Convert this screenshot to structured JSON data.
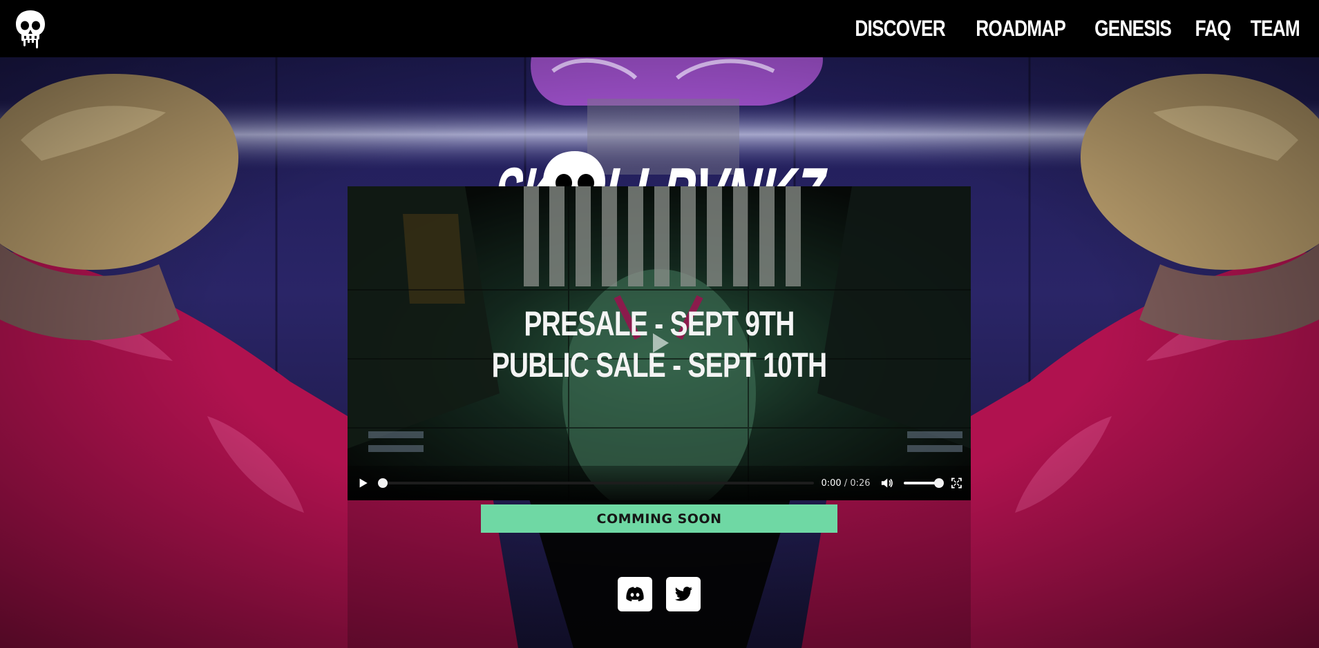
{
  "nav": {
    "logo_icon": "skull-icon",
    "links": [
      {
        "label": "DISCOVER"
      },
      {
        "label": "ROADMAP"
      },
      {
        "label": "GENESIS"
      },
      {
        "label": "FAQ"
      },
      {
        "label": "TEAM"
      }
    ]
  },
  "brand": {
    "text_before": "SK",
    "text_after": "LLPVNKZ",
    "skull_icon": "skull-drip-icon"
  },
  "video": {
    "line1": "PRESALE - SEPT 9TH",
    "line2": "PUBLIC SALE - SEPT 10TH",
    "current_time": "0:00",
    "duration": "0:26",
    "time_separator": " / ",
    "progress": 0,
    "volume": 1
  },
  "cta": {
    "label": "COMMING SOON"
  },
  "socials": [
    {
      "icon": "discord-icon"
    },
    {
      "icon": "twitter-icon"
    }
  ],
  "colors": {
    "nav_bg": "#000000",
    "accent_green": "#6fd8a4",
    "hero_purple": "#1c1a4a",
    "jacket_magenta": "#b0124f",
    "hair_purple": "#9b4fc7"
  }
}
